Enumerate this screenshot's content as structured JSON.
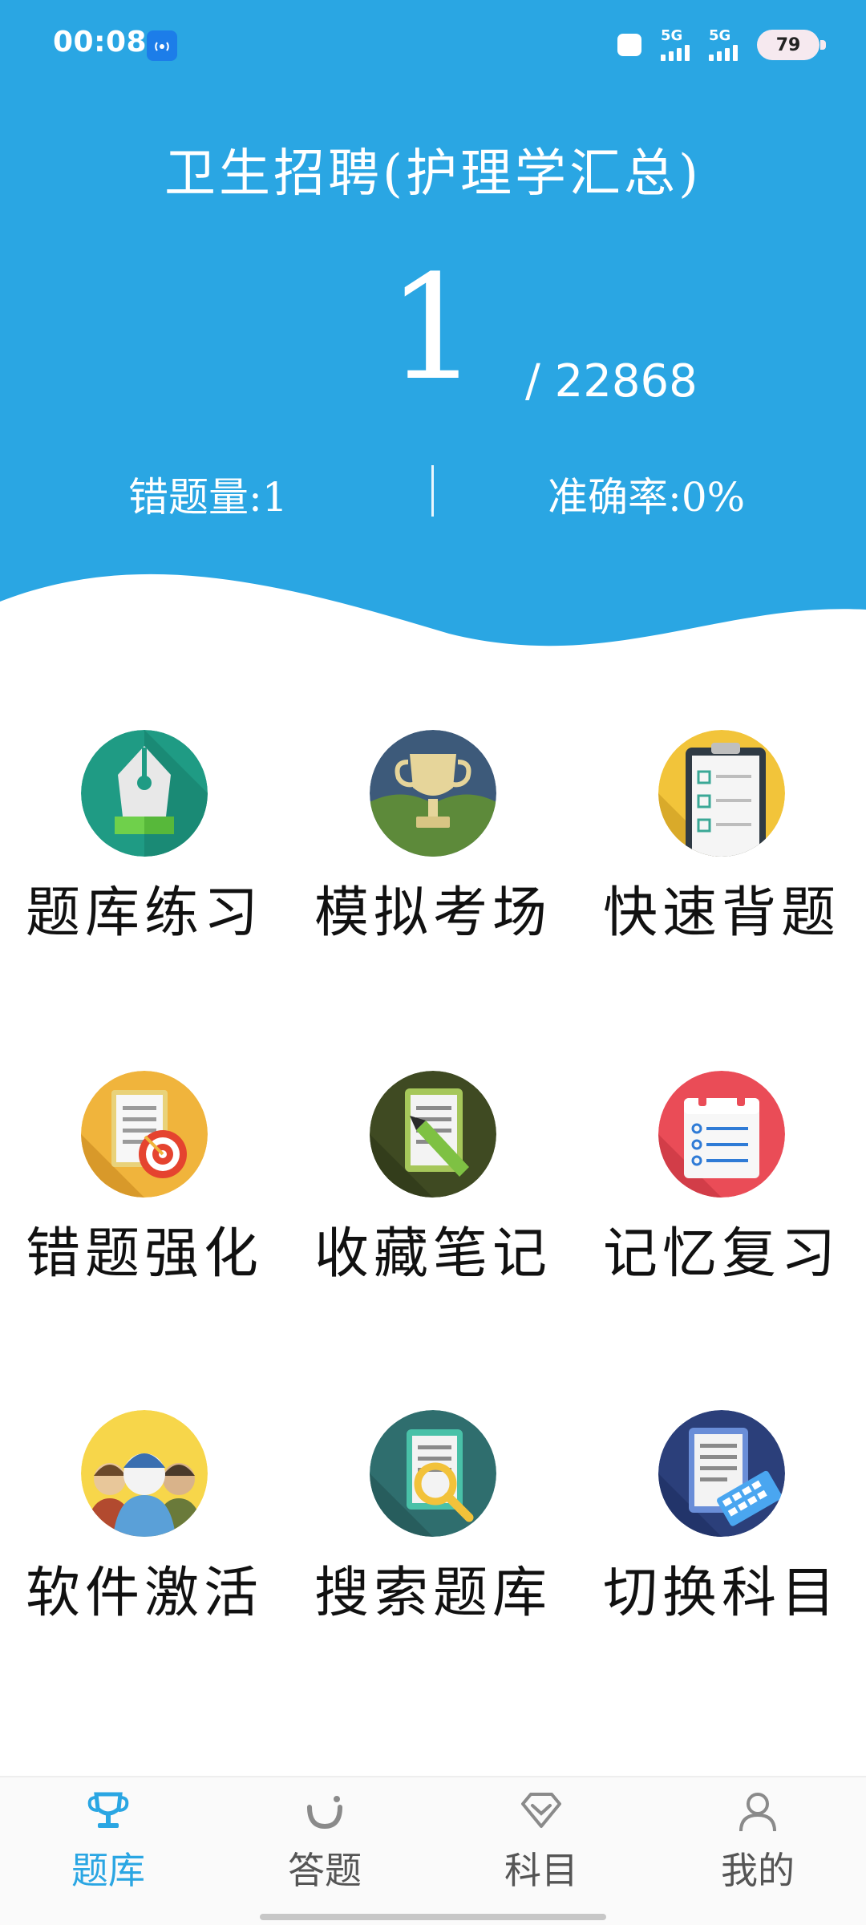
{
  "status_bar": {
    "time": "00:08",
    "network": [
      "5G",
      "5G"
    ],
    "battery": "79"
  },
  "header": {
    "title": "卫生招聘(护理学汇总)",
    "current": "1",
    "total": "/ 22868",
    "wrong_count": "错题量:1",
    "accuracy": "准确率:0%"
  },
  "menu": [
    {
      "label": "题库练习",
      "icon": "pen-nib-icon"
    },
    {
      "label": "模拟考场",
      "icon": "trophy-icon"
    },
    {
      "label": "快速背题",
      "icon": "clipboard-checklist-icon"
    },
    {
      "label": "错题强化",
      "icon": "document-target-icon"
    },
    {
      "label": "收藏笔记",
      "icon": "notes-pencil-icon"
    },
    {
      "label": "记忆复习",
      "icon": "calendar-list-icon"
    },
    {
      "label": "软件激活",
      "icon": "people-group-icon"
    },
    {
      "label": "搜索题库",
      "icon": "document-search-icon"
    },
    {
      "label": "切换科目",
      "icon": "document-keyboard-icon"
    }
  ],
  "nav": [
    {
      "label": "题库",
      "icon": "trophy-icon",
      "active": true
    },
    {
      "label": "答题",
      "icon": "smile-icon",
      "active": false
    },
    {
      "label": "科目",
      "icon": "diamond-icon",
      "active": false
    },
    {
      "label": "我的",
      "icon": "user-icon",
      "active": false
    }
  ],
  "colors": {
    "accent": "#2aa6e3",
    "inactive_nav": "#555555"
  }
}
